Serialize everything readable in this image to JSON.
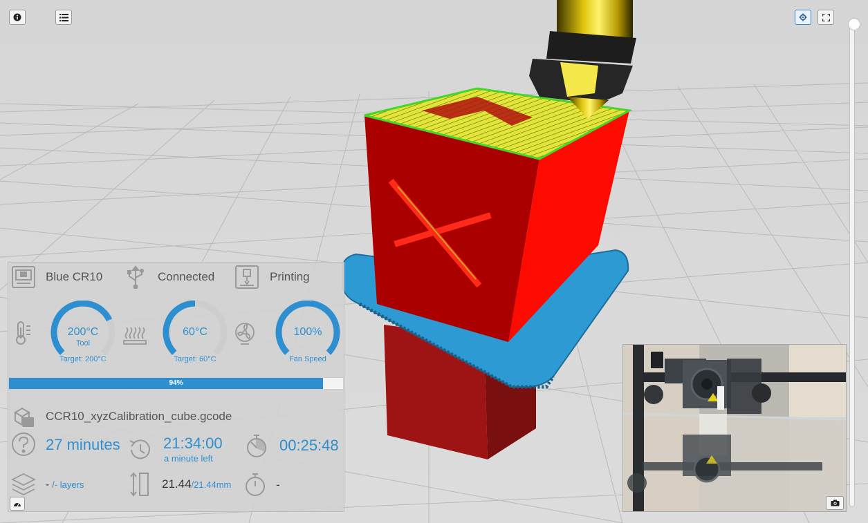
{
  "app": {
    "info_icon": "info-icon",
    "list_icon": "list-icon",
    "settings_icon": "gear-icon",
    "fullscreen_icon": "fullscreen-icon",
    "accent_color": "#2d8fcf"
  },
  "status": {
    "printer_name": "Blue CR10",
    "connection": "Connected",
    "state": "Printing"
  },
  "gauges": {
    "tool": {
      "value": "200°C",
      "label": "Tool",
      "target": "Target: 200°C",
      "fraction": 0.74
    },
    "bed": {
      "value": "60°C",
      "target": "Target: 60°C",
      "fraction": 0.5
    },
    "fan": {
      "value": "100%",
      "target": "Fan Speed",
      "fraction": 1.0
    }
  },
  "progress": {
    "percent": 94,
    "label": "94%"
  },
  "job": {
    "filename": "CCR10_xyzCalibration_cube.gcode",
    "estimate": "27 minutes",
    "eta_time": "21:34:00",
    "eta_left": "a minute left",
    "elapsed": "00:25:48",
    "layers_current": "-",
    "layers_total": "/- layers",
    "height_current": "21.44",
    "height_total": "/21.44mm",
    "timer": "-"
  }
}
